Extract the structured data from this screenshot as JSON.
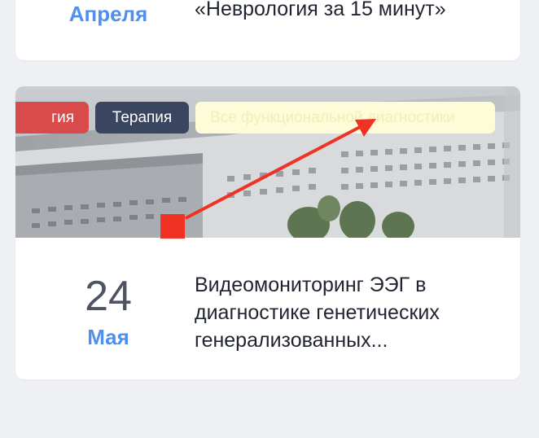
{
  "prev_card": {
    "month": "Апреля",
    "title": "«Неврология за 15 минут»"
  },
  "card": {
    "tags": [
      "гия",
      "Терапия",
      "Все функциональной диагностики"
    ],
    "day": "24",
    "month": "Мая",
    "title_lines": [
      "Видеомониторинг ЭЭГ в",
      "диагностике генетических",
      "генерализованных..."
    ]
  },
  "colors": {
    "background": "#eef0f4",
    "accent_month": "#4f8ff0",
    "tag_red": "#d94a4a",
    "tag_dark": "#3a4660",
    "tag_yellow": "#fdfbd8",
    "annotation_red": "#f03224"
  }
}
